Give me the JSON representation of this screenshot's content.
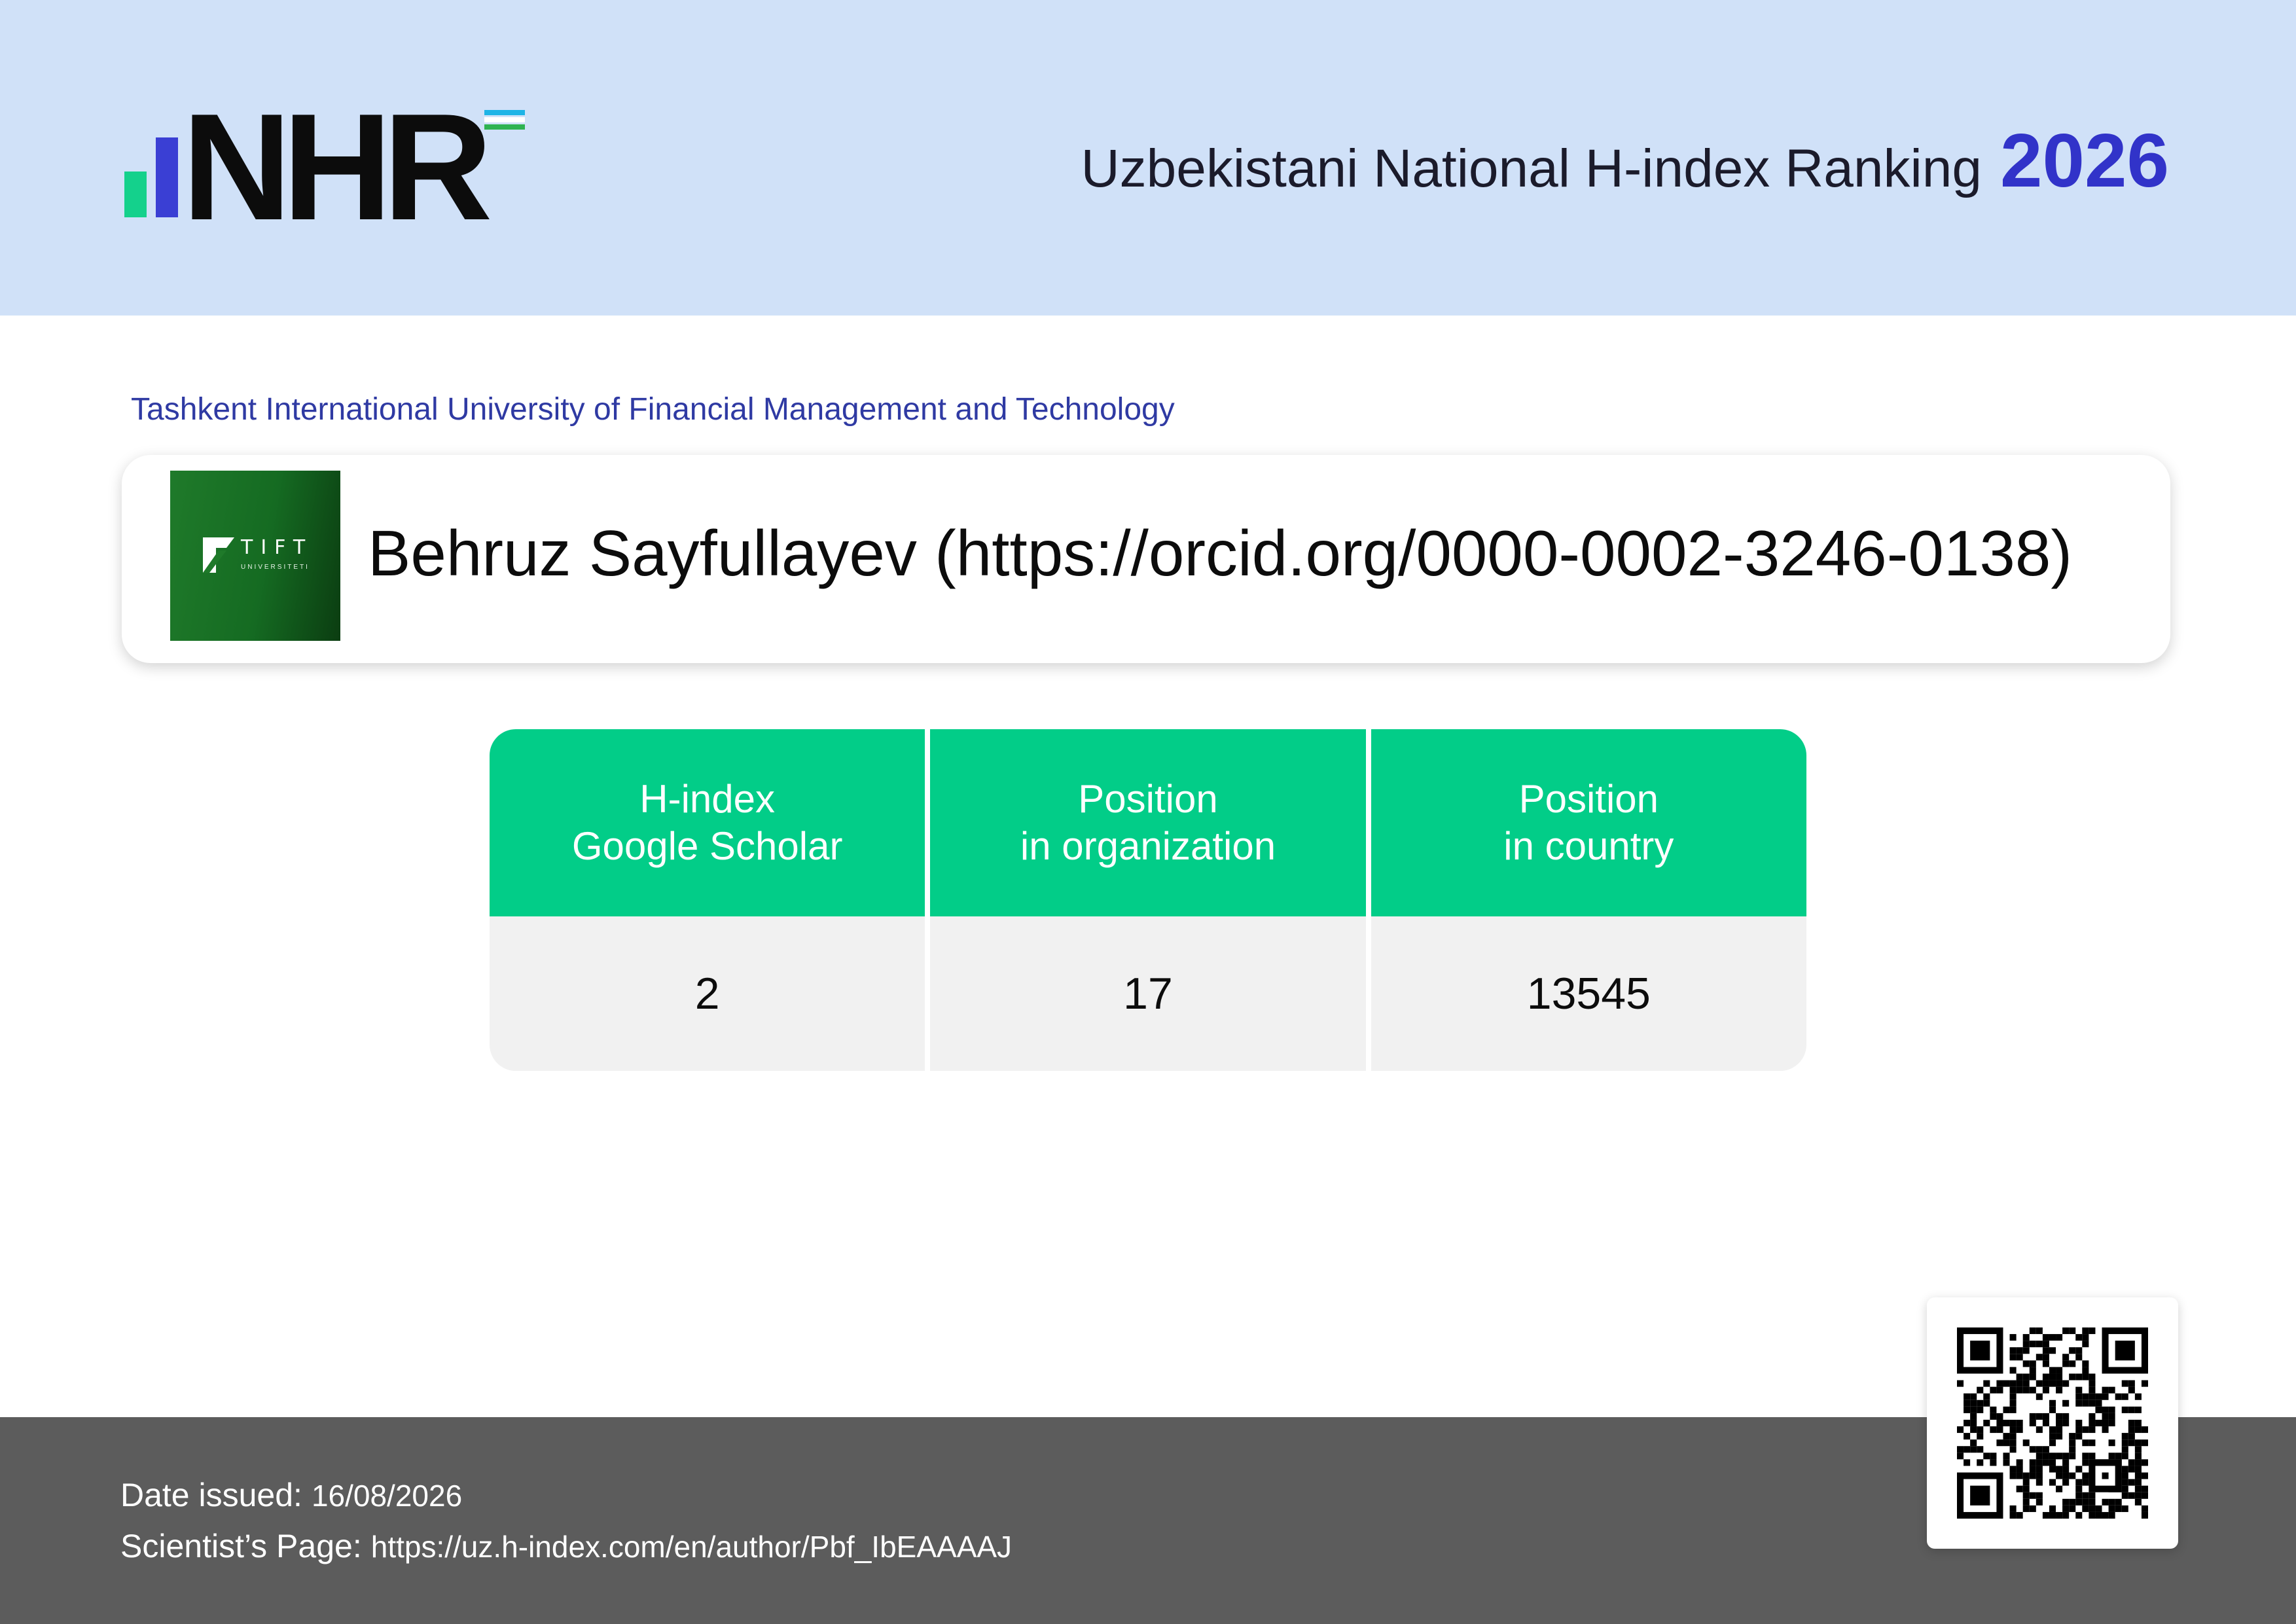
{
  "header": {
    "logo_text": "NHR",
    "title": "Uzbekistani National H-index Ranking",
    "year": "2026",
    "colors": {
      "band": "#d0e1f8",
      "year": "#3133c9",
      "logo_green": "#14d18c",
      "logo_blue": "#3a3fd4"
    }
  },
  "organization": {
    "name": "Tashkent International University of Financial Management and Technology",
    "logo_wordmark": "TIFT",
    "logo_subtext": "UNIVERSITETI"
  },
  "scientist": {
    "display_name": "Behruz Sayfullayev (https://orcid.org/0000-0002-3246-0138)"
  },
  "stats": {
    "columns": [
      {
        "header_line1": "H-index",
        "header_line2": "Google Scholar",
        "value": "2"
      },
      {
        "header_line1": "Position",
        "header_line2": "in organization",
        "value": "17"
      },
      {
        "header_line1": "Position",
        "header_line2": "in country",
        "value": "13545"
      }
    ],
    "colors": {
      "header": "#02cd88",
      "cell": "#f1f1f1"
    }
  },
  "footer": {
    "date_label": "Date issued:",
    "date_value": "16/08/2026",
    "page_label": "Scientist’s Page:",
    "page_value": "https://uz.h-index.com/en/author/Pbf_IbEAAAAJ"
  }
}
